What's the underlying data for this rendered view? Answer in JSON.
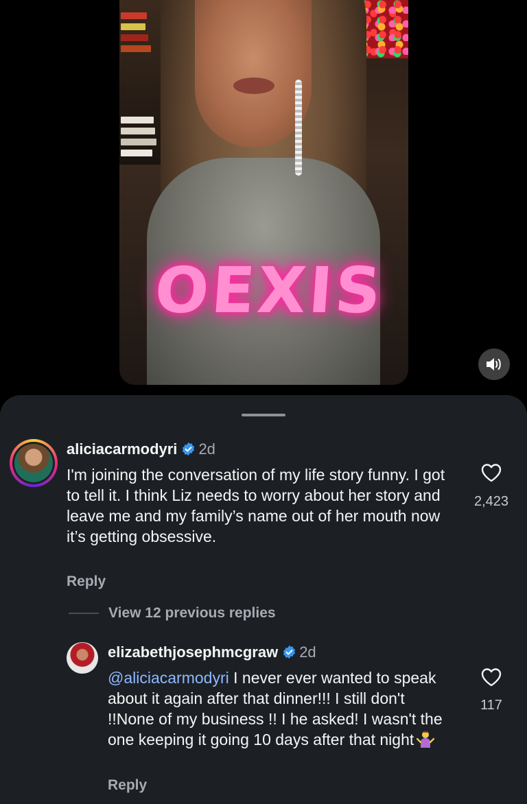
{
  "video": {
    "shirt_text": "OEXIS",
    "sound_icon": "speaker-icon"
  },
  "comments": [
    {
      "username": "aliciacarmodyri",
      "time": "2d",
      "text": "I'm joining the conversation of my life story funny. I got to tell it. I think Liz needs to worry about her story and leave me and my family’s name out of her mouth now it’s getting obsessive.",
      "likes": "2,423",
      "reply_label": "Reply"
    },
    {
      "username": "elizabethjosephmcgraw",
      "time": "2d",
      "mention": "@aliciacarmodyri",
      "text": " I never ever  wanted to speak about it again after that dinner!!! I still don't !!None of my business !! I he asked!  I wasn't the one keeping it going 10 days after that night",
      "likes": "117",
      "reply_label": "Reply"
    }
  ],
  "view_replies_label": "View 12 previous replies",
  "colors": {
    "sheet_bg": "#1c2025",
    "verified": "#3897f0",
    "mention": "#8fb8ff",
    "secondary_text": "#a8abb0"
  }
}
